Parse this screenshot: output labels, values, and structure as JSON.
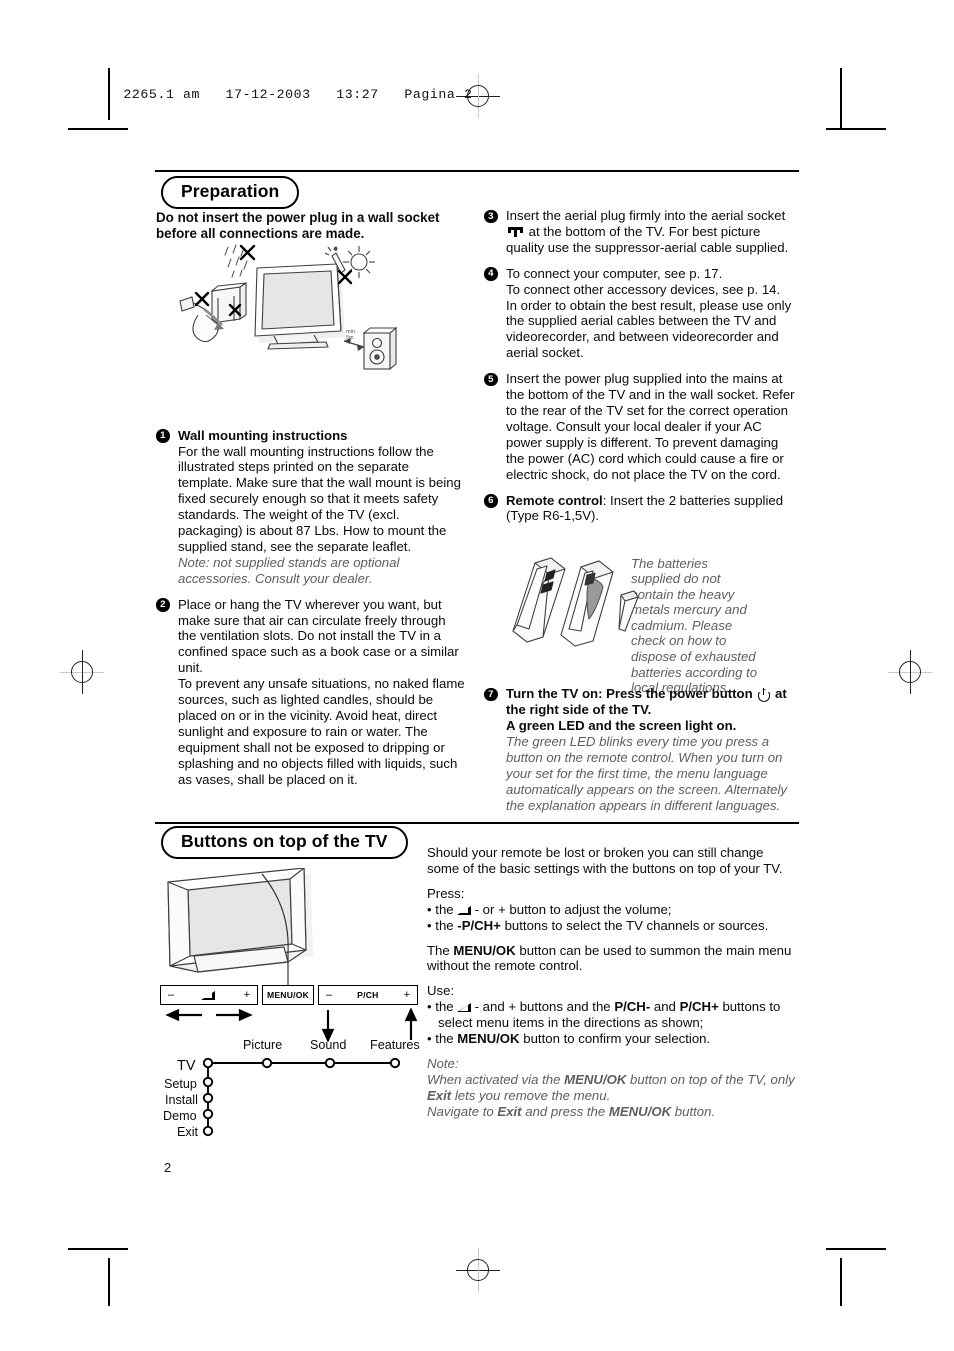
{
  "scan_header": {
    "text": "2265.1 am   17-12-2003   13:27   Pagina 2"
  },
  "page_number": "2",
  "sections": [
    {
      "id": "preparation",
      "title": "Preparation",
      "lead": "Do not insert the power plug in a wall socket before all connections are made."
    },
    {
      "id": "buttons-on-top",
      "title": "Buttons on top of the TV"
    }
  ],
  "left_column": {
    "items": [
      {
        "number": "1",
        "heading": "Wall mounting instructions",
        "body": "For the wall mounting instructions follow the illustrated steps printed on the separate template. Make sure that the wall mount is being fixed securely enough so that it meets safety standards. The weight of the TV (excl. packaging) is about 87 Lbs. How to mount the supplied stand, see the separate leaflet.",
        "note": "Note: not supplied stands are optional accessories. Consult your dealer."
      },
      {
        "number": "2",
        "body": "Place or hang the TV wherever you want, but make sure that air can circulate freely through the ventilation slots. Do not install the TV in a confined space such as a book case or a similar unit.",
        "body2": "To prevent any unsafe situations, no naked flame sources, such as lighted candles, should be placed on or in the vicinity. Avoid heat, direct sunlight and exposure to rain or water. The equipment shall not be exposed to dripping or splashing and no objects filled with liquids, such as vases, shall be placed on it."
      }
    ]
  },
  "right_column": {
    "items": [
      {
        "number": "3",
        "body_a": "Insert the aerial plug firmly into the aerial socket",
        "body_b": "at the bottom of the TV.  For best picture quality use the suppressor-aerial cable supplied."
      },
      {
        "number": "4",
        "body": "To connect your computer, see p. 17.",
        "body2": "To connect other accessory devices, see p. 14.",
        "body3": "In order to obtain the best result, please use only the supplied aerial cables between the TV and videorecorder, and between videorecorder and aerial socket."
      },
      {
        "number": "5",
        "body": "Insert the power plug supplied into the mains at the bottom of the TV and in the wall socket. Refer to the rear of the TV set for the correct operation voltage. Consult your local dealer if your AC power supply is different. To prevent damaging the power (AC) cord which could cause a fire or electric shock, do not place the TV on the cord."
      },
      {
        "number": "6",
        "heading": "Remote control",
        "body": ": Insert the 2 batteries supplied (Type R6-1,5V)."
      },
      {
        "number": "7",
        "heading": "Turn the TV on",
        "body_a": ": Press the power button",
        "body_b": "at the right side of the TV.",
        "body_c": "A green LED and the screen light on.",
        "note": "The green LED blinks every time you press a button on the remote control. When you turn on your set for the first time, the menu language automatically appears on the screen. Alternately the explanation appears in different languages."
      }
    ],
    "battery_note": "The batteries supplied do not contain the heavy metals mercury and cadmium. Please check on how to dispose of exhausted batteries according to local regulations."
  },
  "buttons_section": {
    "intro": "Should your remote be lost or broken you can still change some of the basic settings with the buttons on top of your TV.",
    "press_label": "Press:",
    "press_bullets": [
      {
        "pre": "the",
        "icon": "volume-wedge-icon",
        "post": "- or + button to adjust the volume;"
      },
      {
        "pre": "the",
        "bold": "-P/CH+",
        "post": "buttons to select the TV channels or sources."
      }
    ],
    "menu_paragraph_a": "The",
    "menu_paragraph_bold": "MENU/OK",
    "menu_paragraph_b": "button can be used to summon the main menu without the remote control.",
    "use_label": "Use:",
    "use_bullets": [
      {
        "pre": "the",
        "icon": "volume-wedge-icon",
        "mid": "- and + buttons and the",
        "bold1": "P/CH-",
        "mid2": "and",
        "bold2": "P/CH+",
        "post": "buttons to select menu items in the directions as shown;"
      },
      {
        "pre": "the",
        "bold1": "MENU/OK",
        "post": "button to confirm your selection."
      }
    ],
    "note_label": "Note:",
    "note_line1_a": "When activated via the",
    "note_line1_bold": "MENU/OK",
    "note_line1_b": "button on top of the TV, only",
    "note_line2_bold": "Exit",
    "note_line2_b": "lets you remove the menu.",
    "note_line3_a": "Navigate to",
    "note_line3_bold1": "Exit",
    "note_line3_b": "and press the",
    "note_line3_bold2": "MENU/OK",
    "note_line3_c": "button."
  },
  "button_strip": {
    "volume_box": {
      "minus": "–",
      "icon": "volume-wedge-icon",
      "plus": "+"
    },
    "menu_box": {
      "label": "MENU/OK"
    },
    "pch_box": {
      "minus": "–",
      "label": "P/CH",
      "plus": "+"
    }
  },
  "menu_tree": {
    "root": "TV",
    "horizontal_nodes": [
      "Picture",
      "Sound",
      "Features"
    ],
    "vertical_nodes": [
      "Setup",
      "Install",
      "Demo",
      "Exit"
    ]
  },
  "colors": {
    "ink": "#000000",
    "note_gray": "#5e5e5e",
    "paper": "#ffffff",
    "line_art": "#3a3a3a",
    "screen_fill": "#e6e6e6"
  }
}
